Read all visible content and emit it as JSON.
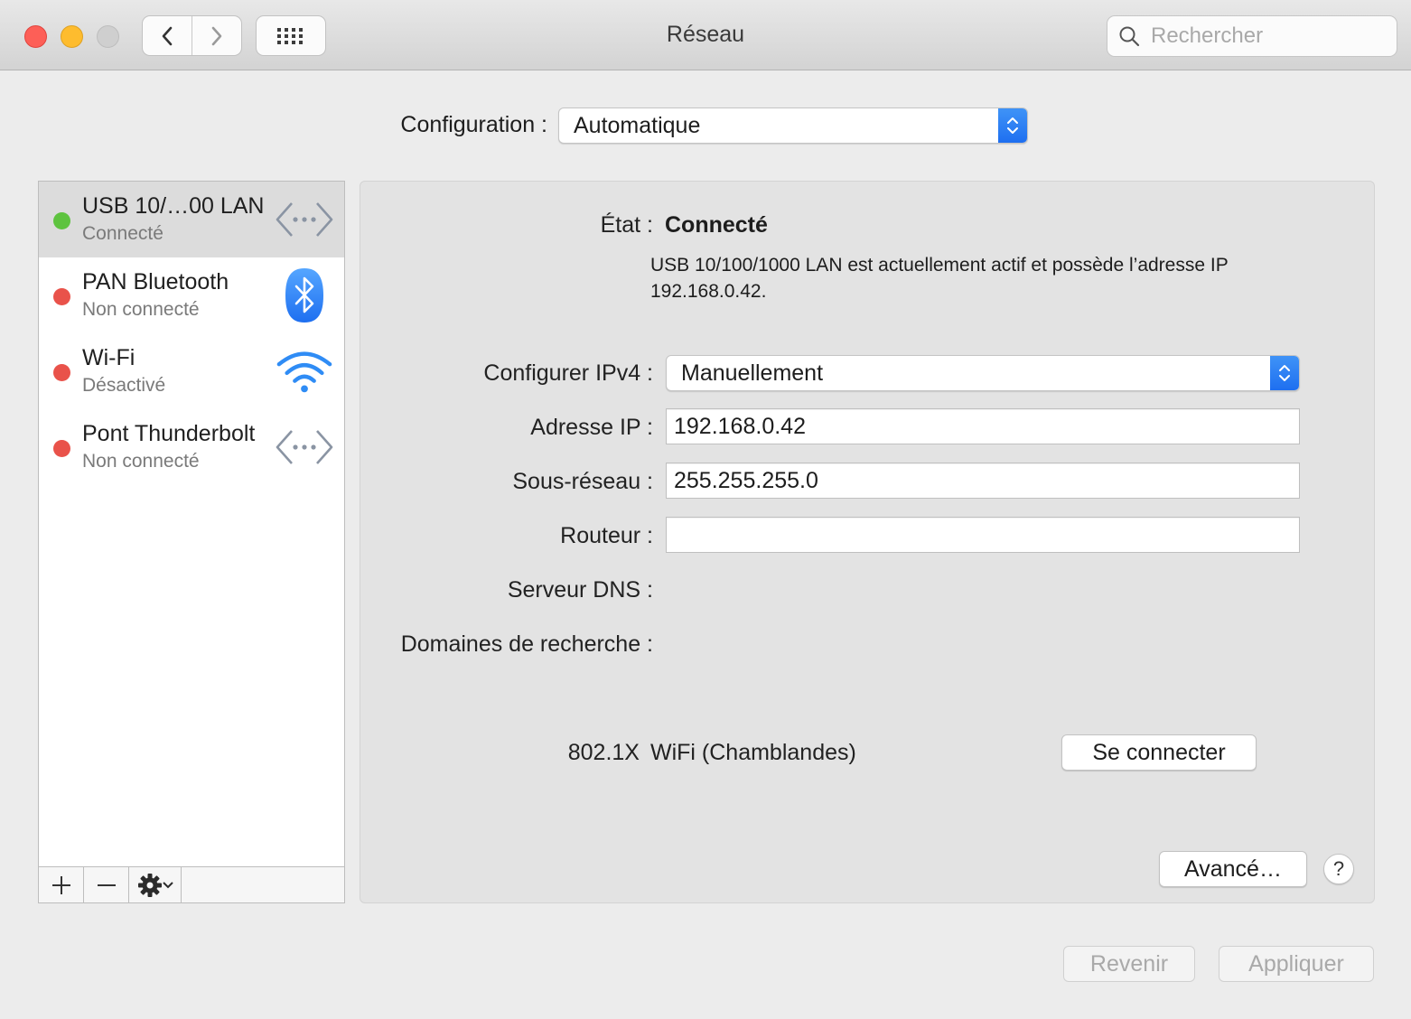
{
  "window": {
    "title": "Réseau"
  },
  "search": {
    "placeholder": "Rechercher"
  },
  "location": {
    "label": "Configuration :",
    "value": "Automatique"
  },
  "services": [
    {
      "name": "USB 10/…00 LAN",
      "status": "Connecté",
      "dot_color": "#5ec33f",
      "icon": "ethernet-icon",
      "selected": true
    },
    {
      "name": "PAN Bluetooth",
      "status": "Non connecté",
      "dot_color": "#e9524a",
      "icon": "bluetooth-icon",
      "selected": false
    },
    {
      "name": "Wi-Fi",
      "status": "Désactivé",
      "dot_color": "#e9524a",
      "icon": "wifi-icon",
      "selected": false
    },
    {
      "name": "Pont Thunderbolt",
      "status": "Non connecté",
      "dot_color": "#e9524a",
      "icon": "thunderbolt-bridge-icon",
      "selected": false
    }
  ],
  "sidebar_toolbar": {
    "add": "+",
    "remove": "—"
  },
  "detail": {
    "status_label": "État :",
    "status_value": "Connecté",
    "status_description": "USB 10/100/1000 LAN est actuellement actif et possède l’adresse IP 192.168.0.42.",
    "ipv4_label": "Configurer IPv4 :",
    "ipv4_value": "Manuellement",
    "ip_label": "Adresse IP :",
    "ip_value": "192.168.0.42",
    "subnet_label": "Sous-réseau :",
    "subnet_value": "255.255.255.0",
    "router_label": "Routeur :",
    "router_value": "",
    "dns_label": "Serveur DNS :",
    "search_domains_label": "Domaines de recherche :",
    "dot1x_label": "802.1X",
    "dot1x_value": "WiFi (Chamblandes)",
    "connect_button": "Se connecter",
    "advanced_button": "Avancé…",
    "help_button": "?"
  },
  "footer": {
    "revert_button": "Revenir",
    "apply_button": "Appliquer"
  },
  "colors": {
    "accent": "#1e6ff0",
    "connected": "#5ec33f",
    "disconnected": "#e9524a"
  }
}
